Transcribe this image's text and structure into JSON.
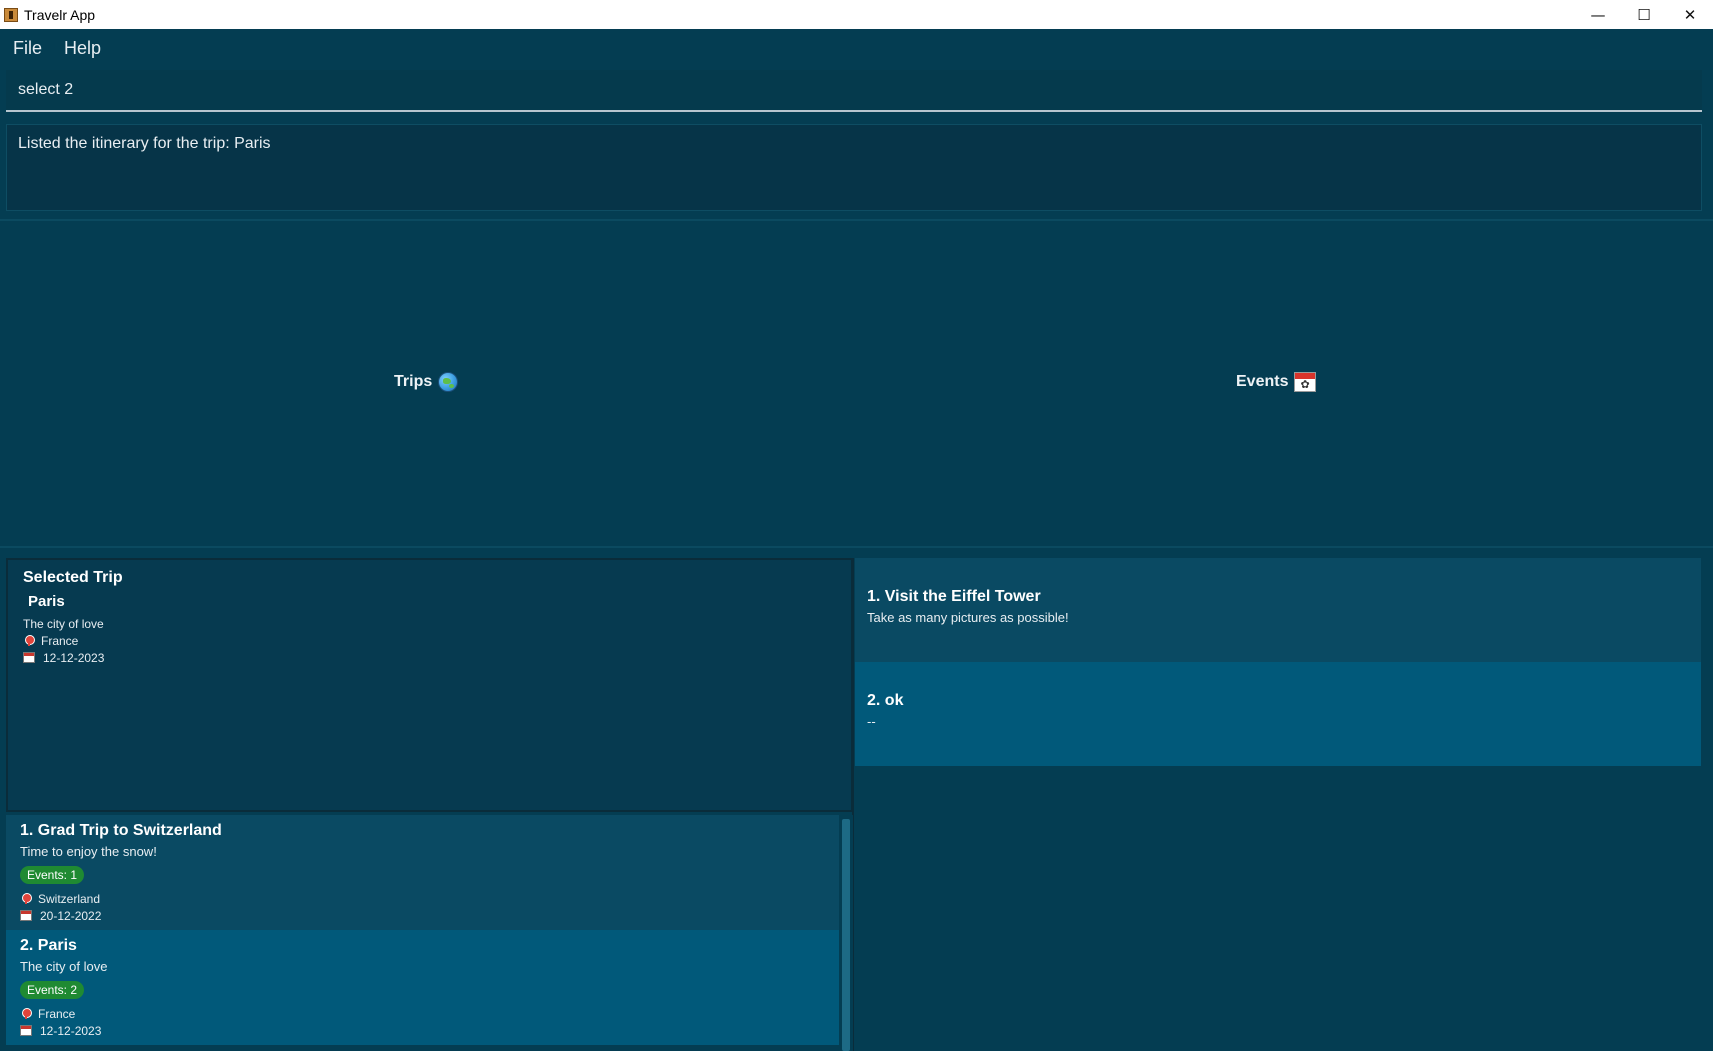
{
  "window": {
    "title": "Travelr App",
    "minimize": "—",
    "maximize": "☐",
    "close": "✕"
  },
  "menu": {
    "file": "File",
    "help": "Help"
  },
  "command": {
    "value": "select 2"
  },
  "result": {
    "text": "Listed the itinerary for the trip: Paris"
  },
  "tabs": {
    "trips": {
      "label": "Trips",
      "icon": "globe-icon"
    },
    "events": {
      "label": "Events",
      "icon": "calendar-icon"
    }
  },
  "selected_trip": {
    "heading": "Selected Trip",
    "name": "Paris",
    "description": "The city of love",
    "location": "France",
    "date": "12-12-2023"
  },
  "trips": [
    {
      "title": "1.  Grad Trip to Switzerland",
      "description": "Time to enjoy the snow!",
      "events_badge": "Events: 1",
      "location": "Switzerland",
      "date": "20-12-2022"
    },
    {
      "title": "2.  Paris",
      "description": "The city of love",
      "events_badge": "Events: 2",
      "location": "France",
      "date": "12-12-2023"
    }
  ],
  "events": [
    {
      "title": "1.  Visit the Eiffel Tower",
      "description": "Take as many pictures as possible!"
    },
    {
      "title": "2.  ok",
      "description": "--"
    }
  ],
  "colors": {
    "background": "#043d52",
    "list_item_odd": "#0a4a63",
    "list_item_even": "#01597a",
    "badge": "#1f8a32"
  }
}
